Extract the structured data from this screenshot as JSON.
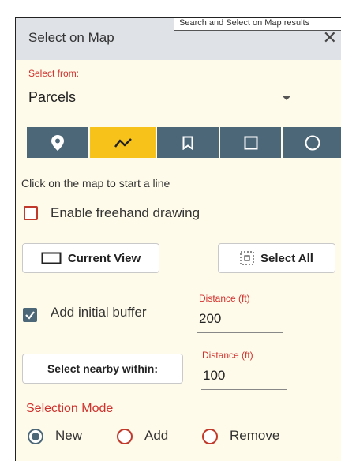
{
  "tooltip": "Search and Select on Map results",
  "header": {
    "title": "Select on Map",
    "close_icon": "close-icon"
  },
  "select_from": {
    "label": "Select from:",
    "value": "Parcels"
  },
  "tools": [
    {
      "name": "point",
      "icon": "map-pin-icon",
      "active": false
    },
    {
      "name": "line",
      "icon": "polyline-icon",
      "active": true
    },
    {
      "name": "bookmark",
      "icon": "bookmark-icon",
      "active": false
    },
    {
      "name": "rectangle",
      "icon": "rectangle-icon",
      "active": false
    },
    {
      "name": "circle",
      "icon": "circle-icon",
      "active": false
    }
  ],
  "hint": "Click on the map to start a line",
  "freehand": {
    "label": "Enable freehand drawing",
    "checked": false
  },
  "current_view": {
    "label": "Current View"
  },
  "select_all": {
    "label": "Select All"
  },
  "buffer": {
    "label": "Add initial buffer",
    "checked": true,
    "distance_label": "Distance (ft)",
    "distance_value": "200"
  },
  "nearby": {
    "label": "Select nearby within:",
    "distance_label": "Distance (ft)",
    "distance_value": "100"
  },
  "selection_mode": {
    "label": "Selection Mode",
    "options": [
      {
        "label": "New",
        "selected": true
      },
      {
        "label": "Add",
        "selected": false
      },
      {
        "label": "Remove",
        "selected": false
      }
    ]
  },
  "colors": {
    "accent": "#f7c31a",
    "toolbar": "#4c6778",
    "label_red": "#d0312d",
    "panel": "#fffbea",
    "header": "#dfe3e8"
  }
}
